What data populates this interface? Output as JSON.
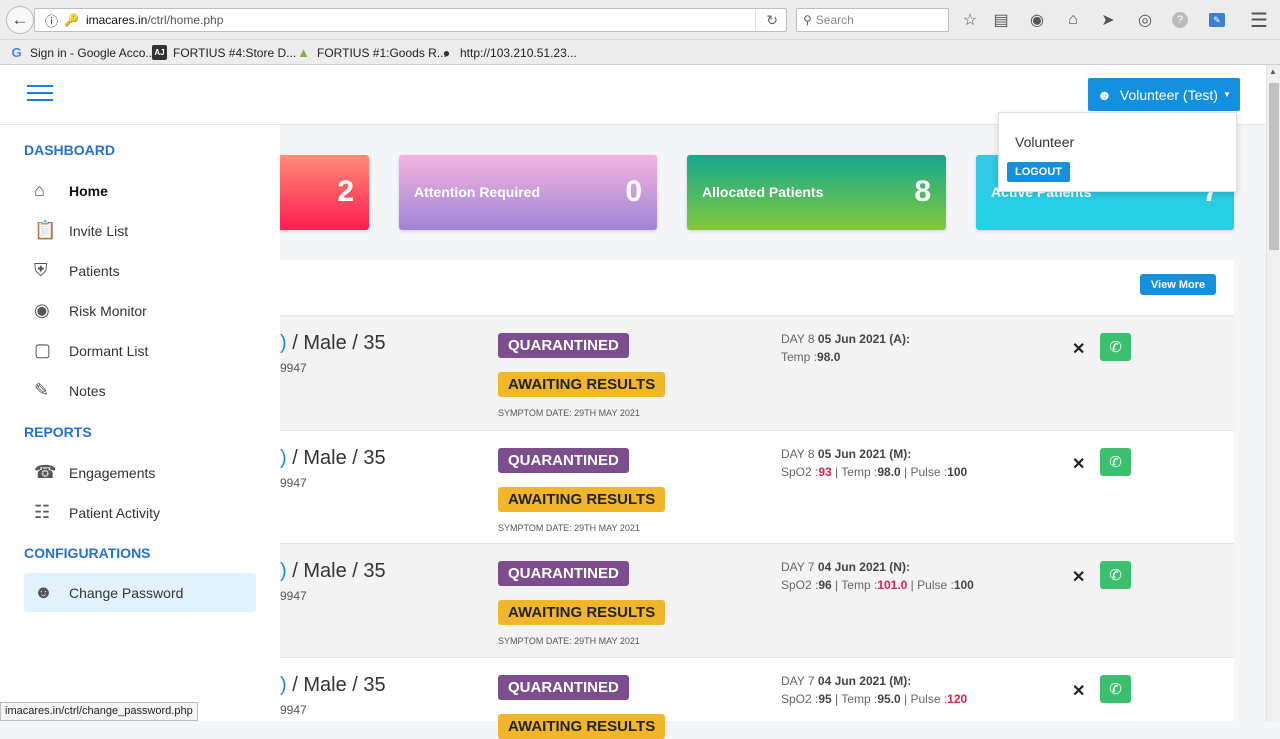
{
  "browser": {
    "url_domain": "imacares.in",
    "url_path": "/ctrl/home.php",
    "search_placeholder": "Search",
    "bookmarks": [
      {
        "label": "Sign in - Google Acco...",
        "icon": "google-icon"
      },
      {
        "label": "FORTIUS #4:Store D...",
        "icon": "fortius-icon"
      },
      {
        "label": "FORTIUS #1:Goods R...",
        "icon": "green-flag-icon"
      },
      {
        "label": "http://103.210.51.23...",
        "icon": "globe-icon"
      }
    ],
    "status_text": "imacares.in/ctrl/change_password.php"
  },
  "user": {
    "button_label": "Volunteer (Test)",
    "role": "Volunteer",
    "logout_label": "LOGOUT"
  },
  "cards": [
    {
      "label": "",
      "value": "2",
      "color_from": "#ff8c7a",
      "color_to": "#ff1c4e"
    },
    {
      "label": "Attention Required",
      "value": "0",
      "color_from": "#f5b3de",
      "color_to": "#9f85d8"
    },
    {
      "label": "Allocated Patients",
      "value": "8",
      "color_from": "#13a88f",
      "color_to": "#84c93c"
    },
    {
      "label": "Active Patients",
      "value": "7",
      "color_from": "#38c6e8",
      "color_to": "#1fd3e2"
    }
  ],
  "panel": {
    "view_more_label": "View More"
  },
  "patients": [
    {
      "name_suffix": ")",
      "details": " / Male / 35",
      "phone": "9947",
      "status": "QUARANTINED",
      "result": "AWAITING RESULTS",
      "symptom_date": "SYMPTOM DATE: 29TH MAY 2021",
      "day": "DAY 8",
      "date": "05 Jun 2021 (A):",
      "vitals": [
        {
          "k": "Temp :",
          "v": "98.0",
          "alert": false
        }
      ]
    },
    {
      "name_suffix": ")",
      "details": " / Male / 35",
      "phone": "9947",
      "status": "QUARANTINED",
      "result": "AWAITING RESULTS",
      "symptom_date": "SYMPTOM DATE: 29TH MAY 2021",
      "day": "DAY 8",
      "date": "05 Jun 2021 (M):",
      "vitals": [
        {
          "k": "SpO2 :",
          "v": "93",
          "alert": true
        },
        {
          "k": "Temp :",
          "v": "98.0",
          "alert": false
        },
        {
          "k": "Pulse :",
          "v": "100",
          "alert": false
        }
      ]
    },
    {
      "name_suffix": ")",
      "details": " / Male / 35",
      "phone": "9947",
      "status": "QUARANTINED",
      "result": "AWAITING RESULTS",
      "symptom_date": "SYMPTOM DATE: 29TH MAY 2021",
      "day": "DAY 7",
      "date": "04 Jun 2021 (N):",
      "vitals": [
        {
          "k": "SpO2 :",
          "v": "96",
          "alert": false
        },
        {
          "k": "Temp :",
          "v": "101.0",
          "alert": true
        },
        {
          "k": "Pulse :",
          "v": "100",
          "alert": false
        }
      ]
    },
    {
      "name_suffix": ")",
      "details": " / Male / 35",
      "phone": "9947",
      "status": "QUARANTINED",
      "result": "AWAITING RESULTS",
      "symptom_date": "",
      "day": "DAY 7",
      "date": "04 Jun 2021 (M):",
      "vitals": [
        {
          "k": "SpO2 :",
          "v": "95",
          "alert": false
        },
        {
          "k": "Temp :",
          "v": "95.0",
          "alert": false
        },
        {
          "k": "Pulse :",
          "v": "120",
          "alert": true
        }
      ]
    }
  ],
  "sidebar": {
    "sections": [
      {
        "title": "DASHBOARD",
        "items": [
          {
            "label": "Home",
            "icon": "home-icon",
            "active": false,
            "bold": true
          },
          {
            "label": "Invite List",
            "icon": "clipboard-icon"
          },
          {
            "label": "Patients",
            "icon": "shield-icon"
          },
          {
            "label": "Risk Monitor",
            "icon": "eye-icon"
          },
          {
            "label": "Dormant List",
            "icon": "box-icon"
          },
          {
            "label": "Notes",
            "icon": "edit-icon"
          }
        ]
      },
      {
        "title": "REPORTS",
        "items": [
          {
            "label": "Engagements",
            "icon": "headset-icon"
          },
          {
            "label": "Patient Activity",
            "icon": "book-icon"
          }
        ]
      },
      {
        "title": "CONFIGURATIONS",
        "items": [
          {
            "label": "Change Password",
            "icon": "user-badge-icon",
            "active": true
          }
        ]
      }
    ]
  }
}
